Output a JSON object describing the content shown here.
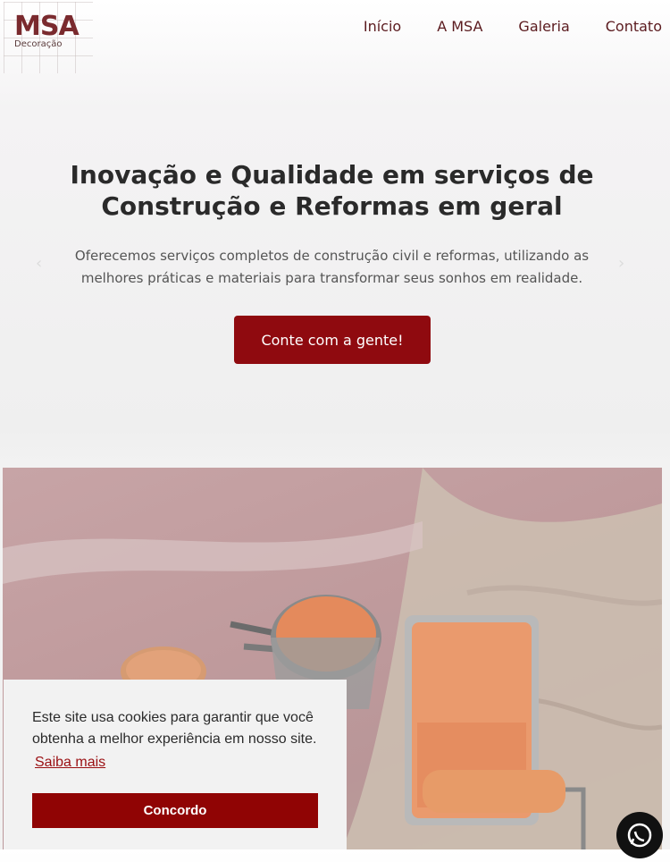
{
  "brand": {
    "logo_main": "MSA",
    "logo_sub": "Decoração"
  },
  "nav": {
    "items": [
      {
        "label": "Início"
      },
      {
        "label": "A MSA"
      },
      {
        "label": "Galeria"
      },
      {
        "label": "Contato"
      }
    ]
  },
  "hero": {
    "title_line1": "Inovação e Qualidade em serviços de",
    "title_line2": "Construção e Reformas em geral",
    "subtitle_line1": "Oferecemos serviços completos de construção civil e reformas, utilizando as",
    "subtitle_line2": "melhores práticas e materiais para transformar seus sonhos em realidade.",
    "cta_label": "Conte com a gente!",
    "prev_arrow": "‹",
    "next_arrow": "›"
  },
  "cookie": {
    "text_line1": "Este site usa cookies para garantir que você",
    "text_line2": "obtenha a melhor experiência em nosso site.",
    "learn_more": "Saiba mais",
    "accept": "Concordo"
  },
  "colors": {
    "brand": "#7a2a2e",
    "accent": "#8f0a0f",
    "cookie_button": "#900404"
  },
  "icons": {
    "whatsapp": "whatsapp-icon"
  }
}
